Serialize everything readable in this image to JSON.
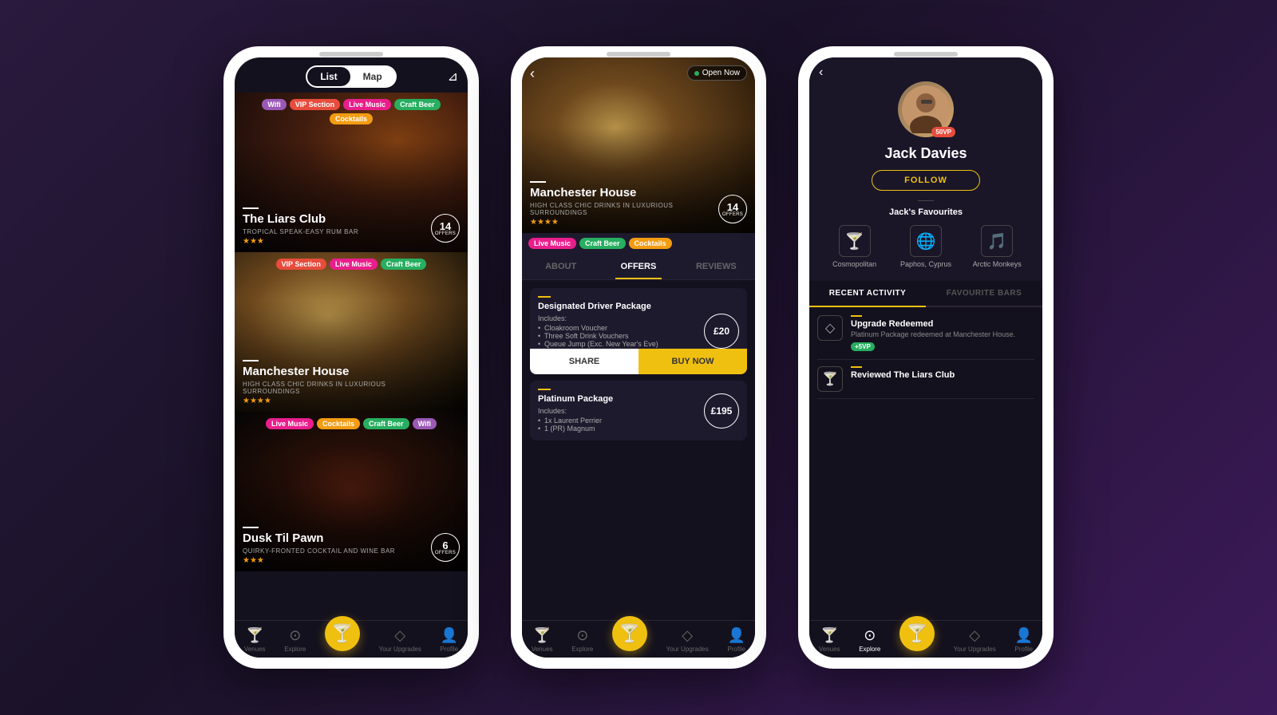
{
  "phone1": {
    "toggle": {
      "list_label": "List",
      "map_label": "Map",
      "active": "list"
    },
    "venues": [
      {
        "name": "The Liars Club",
        "subtitle": "TROPICAL SPEAK-EASY RUM BAR",
        "stars": 3,
        "offers": 14,
        "tags": [
          "Wifi",
          "VIP Section",
          "Live Music",
          "Craft Beer",
          "Cocktails"
        ]
      },
      {
        "name": "Manchester House",
        "subtitle": "HIGH CLASS CHIC DRINKS IN LUXURIOUS SURROUNDINGS",
        "stars": 4,
        "tags": [
          "VIP Section",
          "Live Music",
          "Craft Beer"
        ]
      },
      {
        "name": "Dusk Til Pawn",
        "subtitle": "QUIRKY-FRONTED COCKTAIL AND WINE BAR",
        "stars": 3,
        "offers": 6,
        "tags": [
          "Live Music",
          "Cocktails",
          "Craft Beer",
          "Wifi"
        ]
      }
    ],
    "nav": {
      "venues": "Venues",
      "explore": "Explore",
      "upgrades": "Your Upgrades",
      "profile": "Profile"
    }
  },
  "phone2": {
    "venue_name": "Manchester House",
    "venue_subtitle": "HIGH CLASS CHIC DRINKS IN LUXURIOUS SURROUNDINGS",
    "stars": 4,
    "offers_count": 14,
    "open_now": "Open Now",
    "tags": [
      "Live Music",
      "Craft Beer",
      "Cocktails"
    ],
    "tabs": [
      "ABOUT",
      "OFFERS",
      "REVIEWS"
    ],
    "active_tab": "OFFERS",
    "offers": [
      {
        "title": "Designated Driver Package",
        "includes_label": "Includes:",
        "items": [
          "Cloakroom Voucher",
          "Three Soft Drink Vouchers",
          "Queue Jump (Exc. New Year's Eve)"
        ],
        "price": "£20",
        "share_label": "SHARE",
        "buy_label": "BUY NOW"
      },
      {
        "title": "Platinum Package",
        "includes_label": "Includes:",
        "items": [
          "1x Laurent Perrier",
          "1 (PR) Magnum"
        ],
        "price": "£195"
      }
    ],
    "nav": {
      "venues": "Venues",
      "explore": "Explore",
      "upgrades": "Your Upgrades",
      "profile": "Profile"
    }
  },
  "phone3": {
    "user_name": "Jack Davies",
    "vp_points": "50VP",
    "follow_label": "FOLLOW",
    "favourites_title": "Jack's Favourites",
    "favourites": [
      {
        "label": "Cosmopolitan",
        "icon": "🍸"
      },
      {
        "label": "Paphos, Cyprus",
        "icon": "🌐"
      },
      {
        "label": "Arctic Monkeys",
        "icon": "🎵"
      }
    ],
    "tabs": {
      "recent": "RECENT ACTIVITY",
      "bars": "FAVOURITE BARS",
      "active": "recent"
    },
    "activities": [
      {
        "title": "Upgrade Redeemed",
        "desc": "Platinum Package redeemed at Manchester House.",
        "vp": "+5VP",
        "icon": "◇"
      },
      {
        "title": "Reviewed The Liars Club",
        "desc": "",
        "icon": "🍸"
      }
    ],
    "nav": {
      "venues": "Venues",
      "explore": "Explore",
      "upgrades": "Your Upgrades",
      "profile": "Profile"
    }
  }
}
